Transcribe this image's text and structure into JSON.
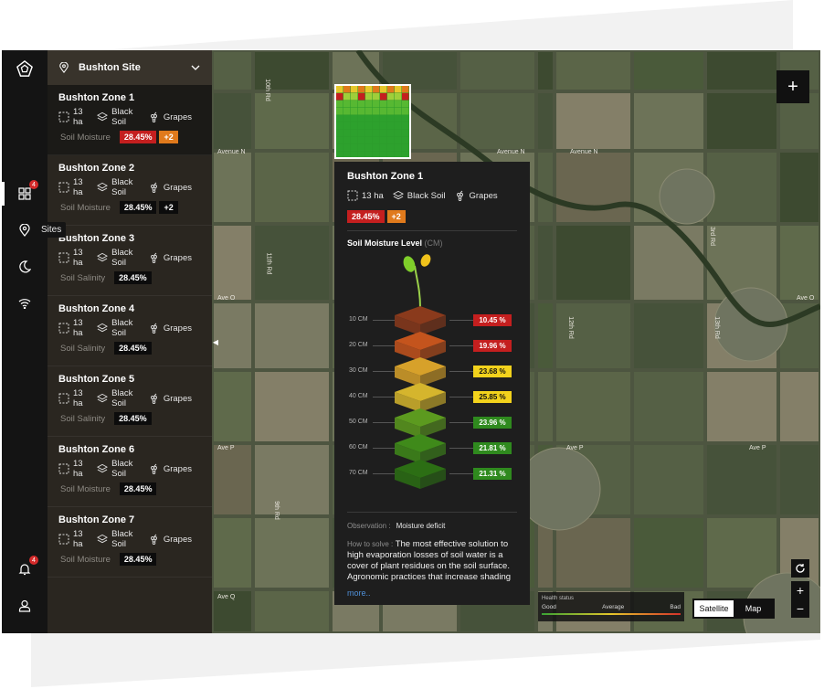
{
  "sidebar_rail": {
    "dashboard_badge": "4",
    "tooltip": "Sites",
    "notifications_badge": "4"
  },
  "site_selector": {
    "label": "Bushton Site"
  },
  "zones": [
    {
      "name": "Bushton Zone 1",
      "area": "13 ha",
      "soil": "Black Soil",
      "crop": "Grapes",
      "metric": "Soil Moisture",
      "value": "28.45%",
      "extra": "+2",
      "style": "red"
    },
    {
      "name": "Bushton Zone 2",
      "area": "13 ha",
      "soil": "Black Soil",
      "crop": "Grapes",
      "metric": "Soil Moisture",
      "value": "28.45%",
      "extra": "+2",
      "style": "dark"
    },
    {
      "name": "Bushton Zone 3",
      "area": "13 ha",
      "soil": "Black Soil",
      "crop": "Grapes",
      "metric": "Soil Salinity",
      "value": "28.45%",
      "extra": "",
      "style": "dark"
    },
    {
      "name": "Bushton Zone 4",
      "area": "13 ha",
      "soil": "Black Soil",
      "crop": "Grapes",
      "metric": "Soil Salinity",
      "value": "28.45%",
      "extra": "",
      "style": "dark"
    },
    {
      "name": "Bushton Zone 5",
      "area": "13 ha",
      "soil": "Black Soil",
      "crop": "Grapes",
      "metric": "Soil Salinity",
      "value": "28.45%",
      "extra": "",
      "style": "dark"
    },
    {
      "name": "Bushton Zone 6",
      "area": "13 ha",
      "soil": "Black Soil",
      "crop": "Grapes",
      "metric": "Soil Moisture",
      "value": "28.45%",
      "extra": "",
      "style": "dark"
    },
    {
      "name": "Bushton Zone 7",
      "area": "13 ha",
      "soil": "Black Soil",
      "crop": "Grapes",
      "metric": "Soil Moisture",
      "value": "28.45%",
      "extra": "",
      "style": "dark"
    }
  ],
  "map": {
    "road_labels": [
      "Avenue N",
      "Avenue N",
      "Avenue N",
      "Ave O",
      "Ave O",
      "Ave P",
      "Ave P",
      "Ave P",
      "Ave Q",
      "Ave Q",
      "10th Rd",
      "11th Rd",
      "12th Rd",
      "13th Rd",
      "9th Rd",
      "3rd Rd"
    ],
    "health": {
      "title": "Health status",
      "good": "Good",
      "average": "Average",
      "bad": "Bad"
    },
    "view_options": [
      "Satellite",
      "Map"
    ],
    "selected_view": "Satellite"
  },
  "popup": {
    "title": "Bushton Zone 1",
    "area": "13 ha",
    "soil": "Black Soil",
    "crop": "Grapes",
    "value": "28.45%",
    "extra": "+2",
    "section_title": "Soil Moisture Level",
    "section_unit": "(CM)",
    "layers": [
      {
        "depth": "10 CM",
        "value": "10.45 %",
        "level": "bad"
      },
      {
        "depth": "20 CM",
        "value": "19.96 %",
        "level": "bad"
      },
      {
        "depth": "30 CM",
        "value": "23.68 %",
        "level": "average"
      },
      {
        "depth": "40 CM",
        "value": "25.85 %",
        "level": "average"
      },
      {
        "depth": "50 CM",
        "value": "23.96 %",
        "level": "good"
      },
      {
        "depth": "60 CM",
        "value": "21.81 %",
        "level": "good"
      },
      {
        "depth": "70 CM",
        "value": "21.31 %",
        "level": "good"
      }
    ],
    "observation_label": "Observation :",
    "observation_value": "Moisture deficit",
    "how_label": "How to solve :",
    "how_text": "The most effective solution to high evaporation losses of soil water is a cover of plant residues on the soil surface. Agronomic practices that increase shading",
    "more": "more.."
  },
  "colors": {
    "bad": "#c41f1f",
    "average": "#f2d21c",
    "good": "#2f8a1e",
    "accent": "#e07a1c"
  }
}
